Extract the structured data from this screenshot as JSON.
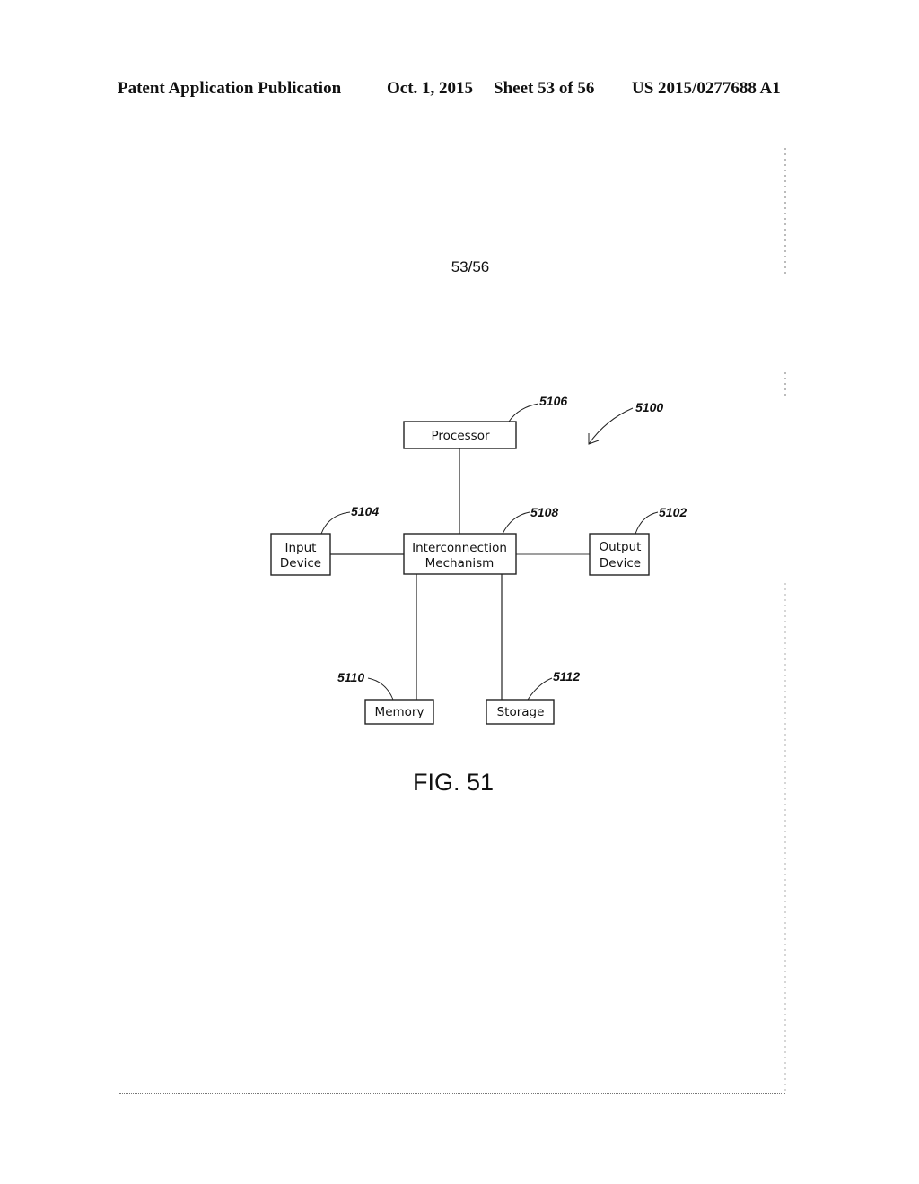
{
  "header": {
    "publication": "Patent Application Publication",
    "date": "Oct. 1, 2015",
    "sheet": "Sheet 53 of 56",
    "document_number": "US 2015/0277688 A1"
  },
  "sheet_number": "53/56",
  "figure": {
    "label": "FIG. 51",
    "system_ref": "5100",
    "nodes": [
      {
        "id": "processor",
        "lines": [
          "Processor"
        ],
        "ref": "5106"
      },
      {
        "id": "interconnection",
        "lines": [
          "Interconnection",
          "Mechanism"
        ],
        "ref": "5108"
      },
      {
        "id": "input",
        "lines": [
          "Input",
          "Device"
        ],
        "ref": "5104"
      },
      {
        "id": "output",
        "lines": [
          "Output",
          "Device"
        ],
        "ref": "5102"
      },
      {
        "id": "memory",
        "lines": [
          "Memory"
        ],
        "ref": "5110"
      },
      {
        "id": "storage",
        "lines": [
          "Storage"
        ],
        "ref": "5112"
      }
    ],
    "edges": [
      {
        "from": "processor",
        "to": "interconnection"
      },
      {
        "from": "input",
        "to": "interconnection"
      },
      {
        "from": "interconnection",
        "to": "output"
      },
      {
        "from": "interconnection",
        "to": "memory"
      },
      {
        "from": "interconnection",
        "to": "storage"
      }
    ]
  }
}
